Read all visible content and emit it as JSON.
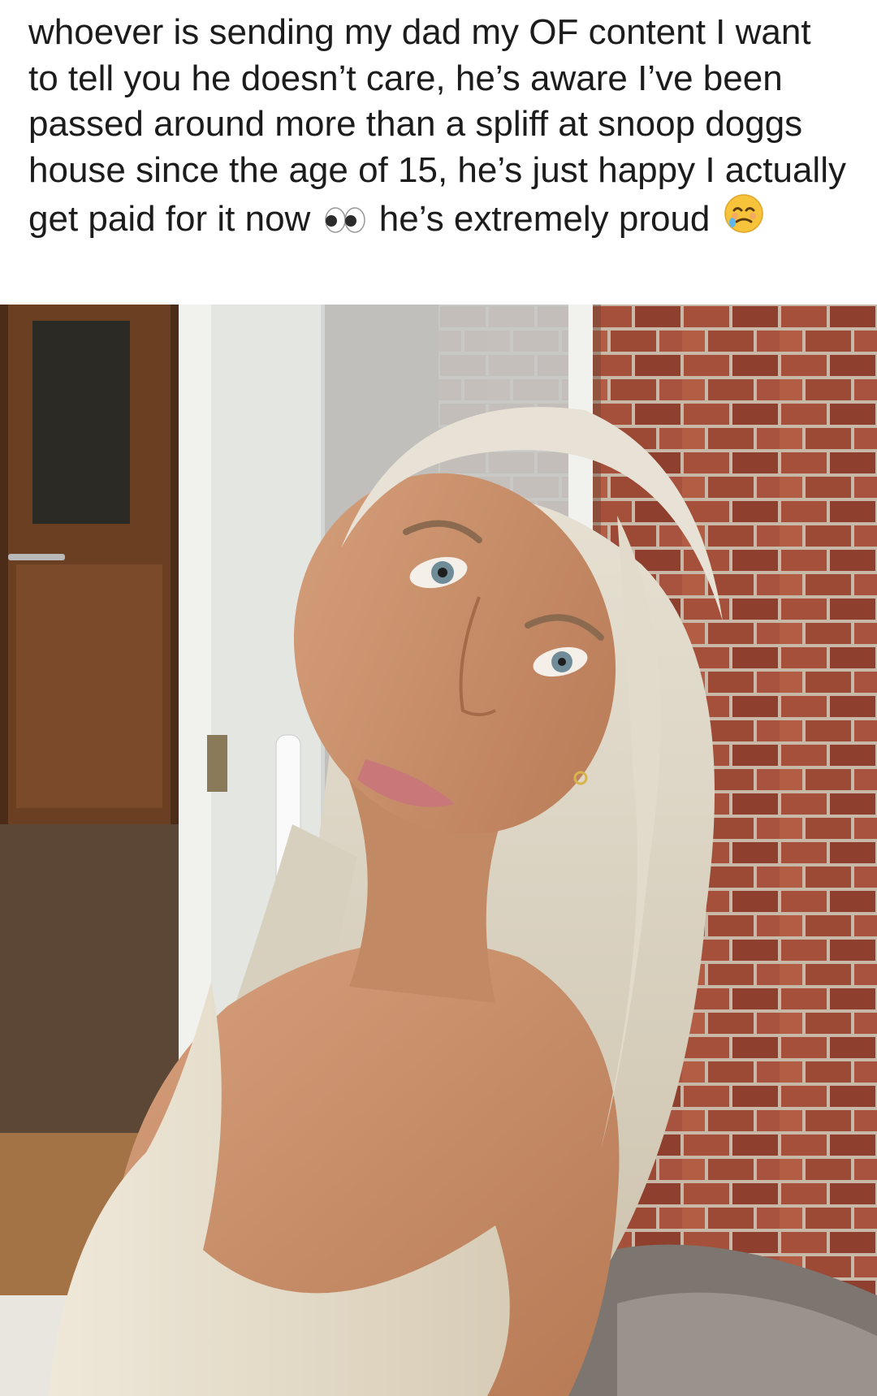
{
  "post": {
    "caption_before_eyes": "whoever is sending my dad my OF content I want to tell you he doesn’t care, he’s aware I’ve been passed around more than a spliff at snoop doggs house since the age of 15, he’s just happy I actually get paid for it now ",
    "caption_after_eyes": " he’s extremely proud ",
    "emoji_eyes": "eyes-emoji",
    "emoji_end": "face-holding-back-tears-emoji"
  },
  "photo": {
    "icon": "photo-of-blonde-woman-by-brick-wall",
    "colors": {
      "brick": "#a5503a",
      "mortar": "#c9b8a8",
      "hair": "#ddd6c6",
      "skin": "#c98e69",
      "dress": "#e7dfcf",
      "door": "#6a3f22",
      "frame": "#f1f1ee"
    }
  }
}
